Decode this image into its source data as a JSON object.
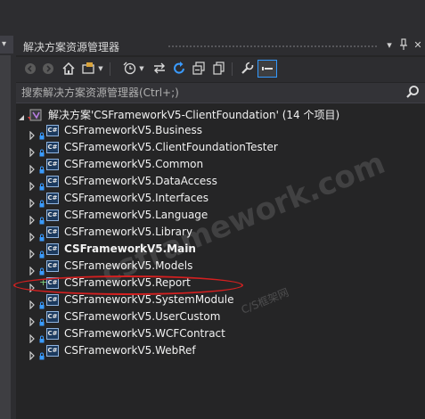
{
  "panel": {
    "title": "解决方案资源管理器",
    "title_buttons": [
      "▾",
      "ᵖ",
      "✕"
    ]
  },
  "toolbar": {
    "buttons": [
      {
        "icon": "back-arrow-icon",
        "glyph": "◀",
        "enabled": false
      },
      {
        "icon": "forward-arrow-icon",
        "glyph": "▶",
        "enabled": false
      },
      {
        "icon": "home-icon",
        "glyph": "⌂"
      },
      {
        "icon": "solution-views-icon",
        "glyph": "▣"
      },
      {
        "icon": "dropdown-arrow-icon",
        "glyph": "▾"
      },
      {
        "icon": "pending-changes-icon",
        "glyph": "◷"
      },
      {
        "icon": "dropdown-arrow-icon",
        "glyph": "▾"
      },
      {
        "icon": "sync-icon",
        "glyph": "⇆"
      },
      {
        "icon": "refresh-icon",
        "glyph": "↻"
      },
      {
        "icon": "collapse-all-icon",
        "glyph": "⧉"
      },
      {
        "icon": "show-all-files-icon",
        "glyph": "❐"
      },
      {
        "icon": "properties-icon",
        "glyph": "🔧"
      },
      {
        "icon": "preview-icon",
        "glyph": "▬"
      }
    ]
  },
  "search": {
    "placeholder": "搜索解决方案资源管理器(Ctrl+;)"
  },
  "solution": {
    "label": "解决方案'CSFrameworkV5-ClientFoundation' (14 个项目)"
  },
  "projects": [
    {
      "name": "CSFrameworkV5.Business",
      "bold": false
    },
    {
      "name": "CSFrameworkV5.ClientFoundationTester",
      "bold": false
    },
    {
      "name": "CSFrameworkV5.Common",
      "bold": false
    },
    {
      "name": "CSFrameworkV5.DataAccess",
      "bold": false
    },
    {
      "name": "CSFrameworkV5.Interfaces",
      "bold": false
    },
    {
      "name": "CSFrameworkV5.Language",
      "bold": false
    },
    {
      "name": "CSFrameworkV5.Library",
      "bold": false
    },
    {
      "name": "CSFrameworkV5.Main",
      "bold": true
    },
    {
      "name": "CSFrameworkV5.Models",
      "bold": false
    },
    {
      "name": "CSFrameworkV5.Report",
      "bold": false,
      "pending_add": true
    },
    {
      "name": "CSFrameworkV5.SystemModule",
      "bold": false
    },
    {
      "name": "CSFrameworkV5.UserCustom",
      "bold": false
    },
    {
      "name": "CSFrameworkV5.WCFContract",
      "bold": false
    },
    {
      "name": "CSFrameworkV5.WebRef",
      "bold": false
    }
  ],
  "csharp_badge": "C#",
  "watermark": {
    "main": "csframework.com",
    "sub": "C/S框架网"
  },
  "colors": {
    "background": "#252526",
    "highlight_ring": "#d42020",
    "active_tool_border": "#3399ff"
  }
}
